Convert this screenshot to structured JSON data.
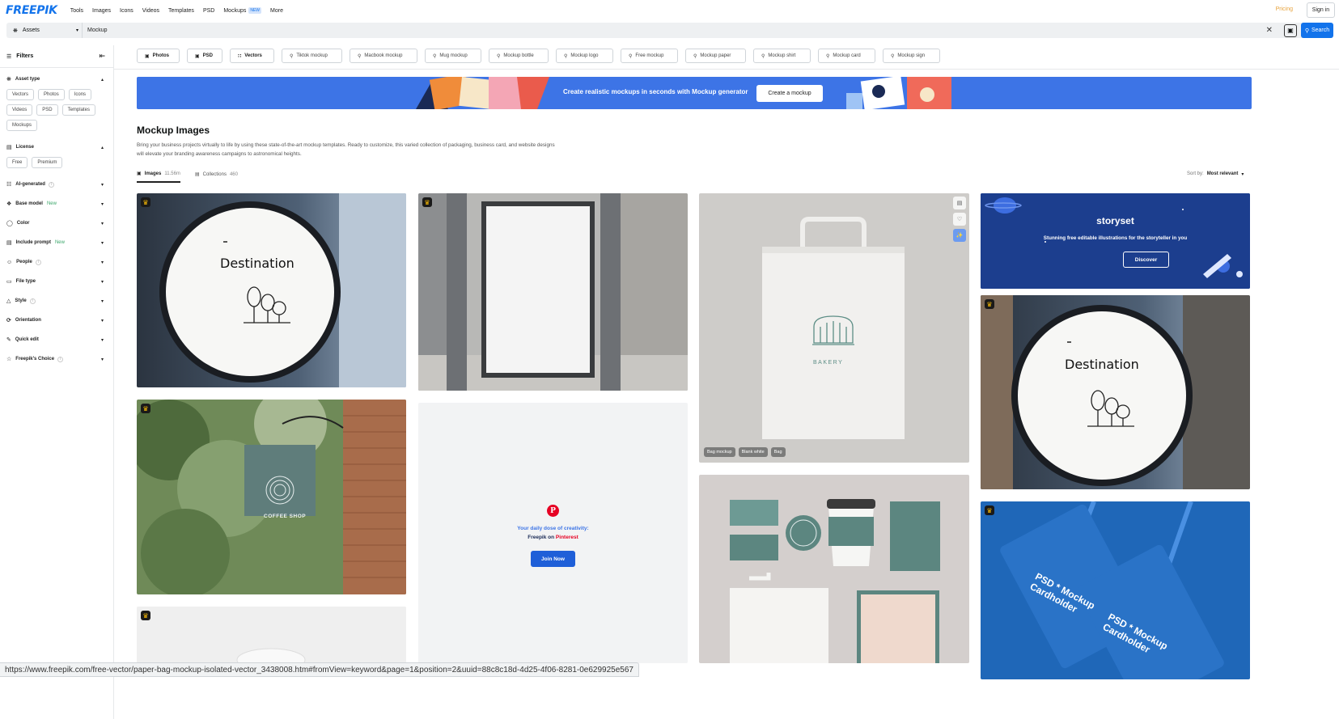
{
  "header": {
    "logo": "FREEPIK",
    "nav": [
      {
        "label": "Tools"
      },
      {
        "label": "Images"
      },
      {
        "label": "Icons"
      },
      {
        "label": "Videos"
      },
      {
        "label": "Templates"
      },
      {
        "label": "PSD"
      },
      {
        "label": "Mockups",
        "badge": "NEW"
      },
      {
        "label": "More"
      }
    ],
    "pricing": "Pricing",
    "signin": "Sign in"
  },
  "search": {
    "scope": "Assets",
    "value": "Mockup",
    "button": "Search"
  },
  "sidebar": {
    "title": "Filters",
    "asset_type": {
      "title": "Asset type",
      "chips": [
        "Vectors",
        "Photos",
        "Icons",
        "Videos",
        "PSD",
        "Templates",
        "Mockups"
      ]
    },
    "license": {
      "title": "License",
      "chips": [
        "Free",
        "Premium"
      ]
    },
    "sections": [
      {
        "label": "AI-generated"
      },
      {
        "label": "Base model",
        "new": "New"
      },
      {
        "label": "Color"
      },
      {
        "label": "Include prompt",
        "new": "New"
      },
      {
        "label": "People"
      },
      {
        "label": "File type"
      },
      {
        "label": "Style"
      },
      {
        "label": "Orientation"
      },
      {
        "label": "Quick edit"
      },
      {
        "label": "Freepik's Choice"
      }
    ]
  },
  "pills": [
    "Photos",
    "PSD",
    "Vectors",
    "Tiktok mockup",
    "Macbook mockup",
    "Mug mockup",
    "Mockup bottle",
    "Mockup logo",
    "Free mockup",
    "Mockup paper",
    "Mockup shirt",
    "Mockup card",
    "Mockup sign"
  ],
  "banner": {
    "text": "Create realistic mockups in seconds with Mockup generator",
    "button": "Create a mockup"
  },
  "page": {
    "title": "Mockup Images",
    "description": "Bring your business projects virtually to life by using these state-of-the-art mockup templates. Ready to customize, this varied collection of packaging, business card, and website designs will elevate your branding awareness campaigns to astronomical heights."
  },
  "tabs": [
    {
      "label": "Images",
      "count": "11.56m"
    },
    {
      "label": "Collections",
      "count": "460"
    }
  ],
  "sort": {
    "label": "Sort by:",
    "value": "Most relevant"
  },
  "cards": {
    "sign1_text": "Destination",
    "bag_brand": "BAKERY",
    "bag_tags": [
      "Bag mockup",
      "Blank white",
      "Bag"
    ],
    "storyset": {
      "name": "storyset",
      "desc": "Stunning free editable illustrations for the storyteller in you",
      "button": "Discover"
    },
    "sign2_text": "Destination",
    "coffee_text": "COFFEE SHOP",
    "pinterest": {
      "line1": "Your daily dose of creativity:",
      "line2_a": "Freepik on",
      "line2_b": "Pinterest",
      "button": "Join Now"
    },
    "cardholder_text_a": "PSD * Mockup Cardholder",
    "cardholder_text_b": "PSD * Mockup Cardholder"
  },
  "statusbar": "https://www.freepik.com/free-vector/paper-bag-mockup-isolated-vector_3438008.htm#fromView=keyword&page=1&position=2&uuid=88c8c18d-4d25-4f06-8281-0e629925e567"
}
